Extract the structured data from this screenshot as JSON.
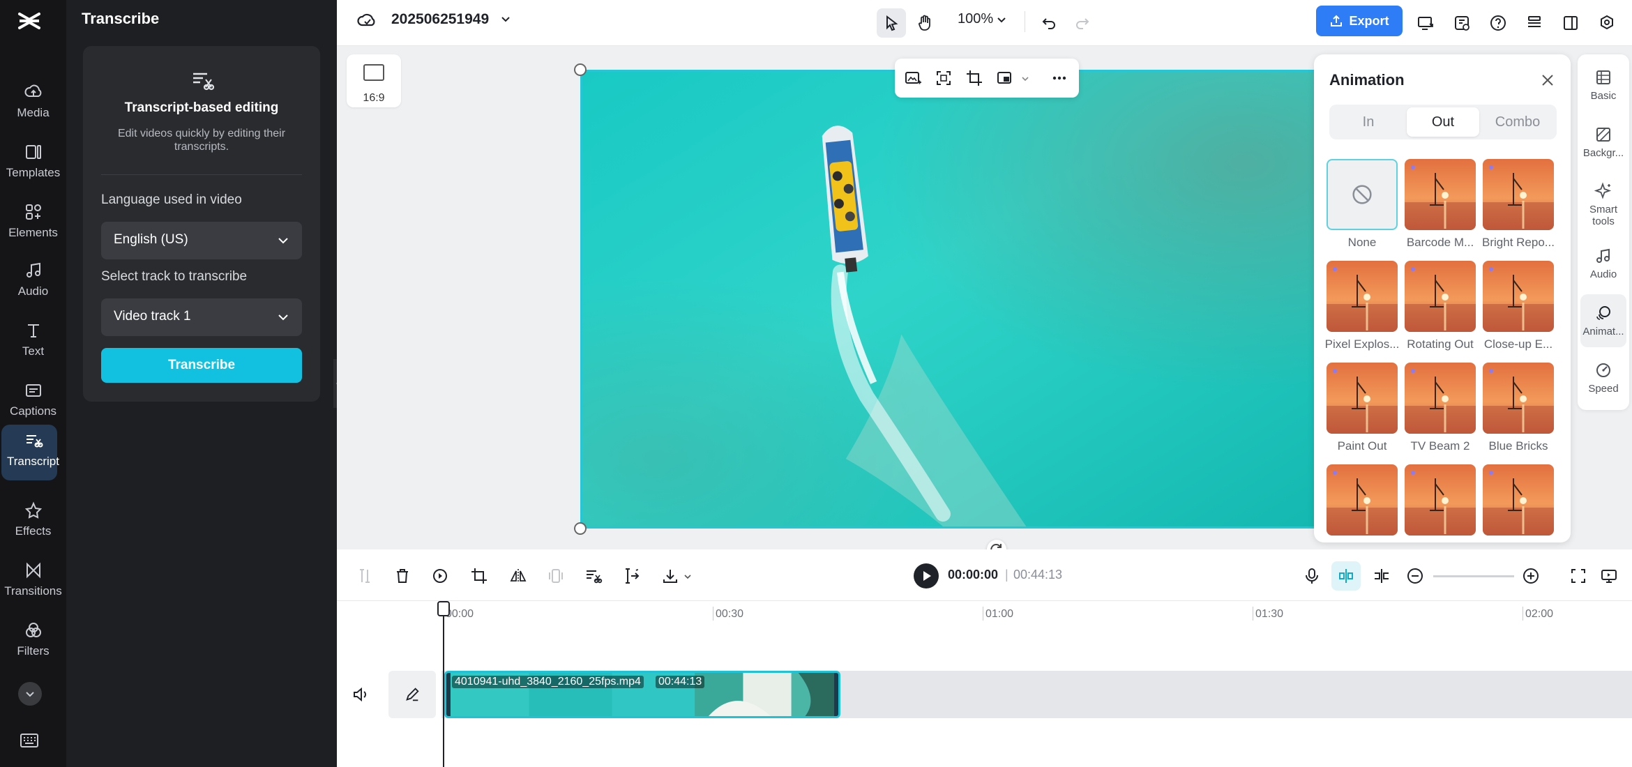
{
  "app": {
    "project_name": "202506251949",
    "zoom": "100%",
    "export_label": "Export"
  },
  "rail": {
    "items": [
      {
        "label": "Media",
        "icon": "cloud-upload-icon"
      },
      {
        "label": "Templates",
        "icon": "templates-icon"
      },
      {
        "label": "Elements",
        "icon": "elements-icon"
      },
      {
        "label": "Audio",
        "icon": "music-note-icon"
      },
      {
        "label": "Text",
        "icon": "text-icon"
      },
      {
        "label": "Captions",
        "icon": "captions-icon"
      },
      {
        "label": "Transcript",
        "icon": "transcript-icon"
      },
      {
        "label": "Effects",
        "icon": "effects-icon"
      },
      {
        "label": "Transitions",
        "icon": "transitions-icon"
      },
      {
        "label": "Filters",
        "icon": "filters-icon"
      }
    ]
  },
  "transcribe_panel": {
    "title": "Transcribe",
    "heading": "Transcript-based editing",
    "description": "Edit videos quickly by editing their transcripts.",
    "language_label": "Language used in video",
    "language_value": "English (US)",
    "track_label": "Select track to transcribe",
    "track_value": "Video track 1",
    "button_label": "Transcribe"
  },
  "canvas": {
    "ratio_label": "16:9"
  },
  "animation_panel": {
    "title": "Animation",
    "tabs": [
      "In",
      "Out",
      "Combo"
    ],
    "active_tab": "Out",
    "items": [
      "None",
      "Barcode M...",
      "Bright Repo...",
      "Pixel Explos...",
      "Rotating Out",
      "Close-up E...",
      "Paint Out",
      "TV Beam 2",
      "Blue Bricks"
    ]
  },
  "right_tools": [
    {
      "label": "Basic",
      "icon": "basic-icon"
    },
    {
      "label": "Backgr...",
      "icon": "background-icon"
    },
    {
      "label": "Smart tools",
      "icon": "sparkle-icon"
    },
    {
      "label": "Audio",
      "icon": "music-note-icon"
    },
    {
      "label": "Animat...",
      "icon": "animation-icon"
    },
    {
      "label": "Speed",
      "icon": "speed-icon"
    }
  ],
  "timeline": {
    "current_time": "00:00:00",
    "total_time": "00:44:13",
    "ruler": [
      "00:00",
      "00:30",
      "01:00",
      "01:30",
      "02:00"
    ],
    "clip_name": "4010941-uhd_3840_2160_25fps.mp4",
    "clip_duration": "00:44:13"
  },
  "colors": {
    "accent": "#12c1e0",
    "export": "#2f7df6",
    "selection": "#25c6d6"
  }
}
